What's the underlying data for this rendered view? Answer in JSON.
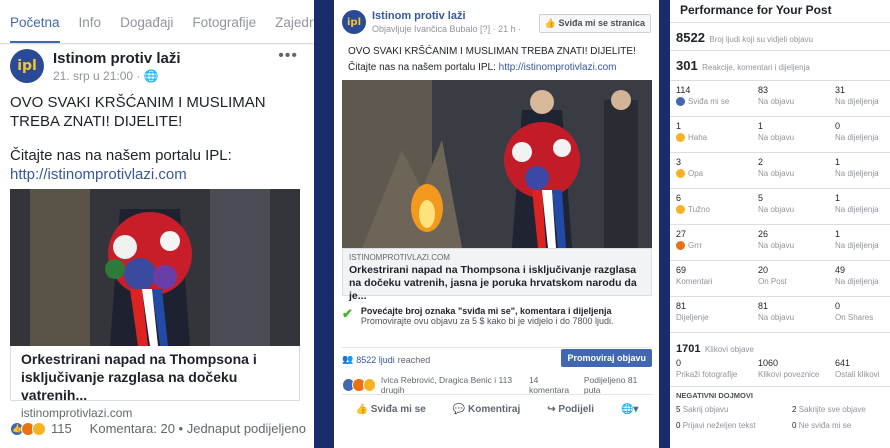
{
  "left": {
    "tabs": [
      "Početna",
      "Info",
      "Događaji",
      "Fotografije",
      "Zajednica"
    ],
    "page_name": "Istinom protiv laži",
    "meta": "21. srp u 21:00 ·",
    "text1": "OVO SVAKI KRŠĆANIM I MUSLIMAN TREBA ZNATI! DIJELITE!",
    "text2": "Čitajte nas na našem portalu IPL:",
    "link": "http://istinomprotivlazi.com",
    "card_title": "Orkestrirani napad na Thompsona i isključivanje razglasa na dočeku vatrenih...",
    "card_domain": "istinomprotivlazi.com",
    "reactions_count": "115",
    "comments": "Komentara: 20 • Jednaput podijeljeno"
  },
  "middle": {
    "page_name": "Istinom protiv laži",
    "meta": "Objavljuje Ivančica Bubalo [?] · 21 h ·",
    "like_page": "Sviđa mi se stranica",
    "text1": "OVO SVAKI KRŠĆANIM I MUSLIMAN TREBA ZNATI! DIJELITE!",
    "text2": "Čitajte nas na našem portalu IPL:",
    "link": "http://istinomprotivlazi.com",
    "link_domain": "ISTINOMPROTIVLAZI.COM",
    "link_title": "Orkestrirani napad na Thompsona i isključivanje razglasa na dočeku vatrenih, jasna je poruka hrvatskom narodu da je...",
    "boost_title": "Povećajte broj oznaka \"sviđa mi se\", komentara i dijeljenja",
    "boost_text": "Promovirajte ovu objavu za 5 $ kako bi je vidjelo i do 7800 ljudi.",
    "reach_count": "8522 ljudi",
    "reach_label": "reached",
    "promote_button": "Promoviraj objavu",
    "reactors": "Ivica Rebrović, Dragica Benic i 113 drugih",
    "comments": "14 komentara",
    "shares": "Podijeljeno 81 puta",
    "actions": [
      "Sviđa mi se",
      "Komentiraj",
      "Podijeli"
    ]
  },
  "right": {
    "title": "Performance for Your Post",
    "reach": {
      "value": "8522",
      "label": "Broj ljudi koji su vidjeli objavu"
    },
    "engagement": {
      "value": "301",
      "label": "Reakcije, komentari i dijeljenja"
    },
    "rows": [
      {
        "icon": "like",
        "color": "#4267b2",
        "c1": [
          "114",
          "Sviđa mi se"
        ],
        "c2": [
          "83",
          "Na objavu"
        ],
        "c3": [
          "31",
          "Na dijeljenja"
        ]
      },
      {
        "icon": "haha",
        "color": "#f7b125",
        "c1": [
          "1",
          "Haha"
        ],
        "c2": [
          "1",
          "Na objavu"
        ],
        "c3": [
          "0",
          "Na dijeljenja"
        ]
      },
      {
        "icon": "wow",
        "color": "#f7b125",
        "c1": [
          "3",
          "Opa"
        ],
        "c2": [
          "2",
          "Na objavu"
        ],
        "c3": [
          "1",
          "Na dijeljenja"
        ]
      },
      {
        "icon": "sad",
        "color": "#f7b125",
        "c1": [
          "6",
          "Tužno"
        ],
        "c2": [
          "5",
          "Na objavu"
        ],
        "c3": [
          "1",
          "Na dijeljenja"
        ]
      },
      {
        "icon": "angry",
        "color": "#e9710f",
        "c1": [
          "27",
          "Grrr"
        ],
        "c2": [
          "26",
          "Na objavu"
        ],
        "c3": [
          "1",
          "Na dijeljenja"
        ]
      },
      {
        "icon": "",
        "color": "",
        "c1": [
          "69",
          "Komentari"
        ],
        "c2": [
          "20",
          "On Post"
        ],
        "c3": [
          "49",
          "Na dijeljenja"
        ]
      },
      {
        "icon": "",
        "color": "",
        "c1": [
          "81",
          "Dijeljenje"
        ],
        "c2": [
          "81",
          "Na objavu"
        ],
        "c3": [
          "0",
          "On Shares"
        ]
      }
    ],
    "clicks": {
      "value": "1701",
      "label": "Klikovi objave"
    },
    "click_cells": [
      [
        "0",
        "Prikaži fotografije"
      ],
      [
        "1060",
        "Klikovi poveznice"
      ],
      [
        "641",
        "Ostali klikovi"
      ]
    ],
    "negative_title": "NEGATIVNI DOJMOVI",
    "negative": [
      [
        "5",
        "Sakrij objavu"
      ],
      [
        "2",
        "Sakrijte sve objave"
      ],
      [
        "0",
        "Prijavi neželjen tekst"
      ],
      [
        "0",
        "Ne sviđa mi se"
      ]
    ]
  }
}
